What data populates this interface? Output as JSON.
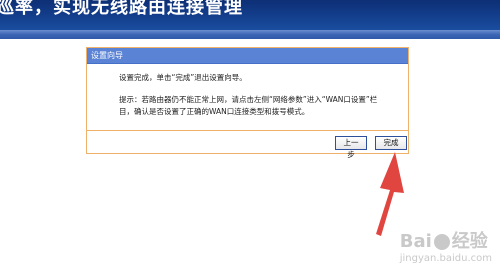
{
  "banner": {
    "text": "巡率，实现无线路由连接管理"
  },
  "wizard": {
    "title": "设置向导",
    "message1": "设置完成，单击“完成”退出设置向导。",
    "message2": "提示：若路由器仍不能正常上网，请点击左侧“网络参数”进入“WAN口设置”栏目，确认是否设置了正确的WAN口连接类型和拨号模式。",
    "prev_button": "上一步",
    "finish_button": "完成"
  },
  "watermark": {
    "logo_text": "Bai",
    "logo_text2": "经验",
    "url": "jingyan.baidu.com"
  },
  "colors": {
    "banner_dark": "#0d2f75",
    "header_blue": "#5a83d6",
    "border_orange": "#f0b26b",
    "arrow_red": "#e0463f"
  }
}
